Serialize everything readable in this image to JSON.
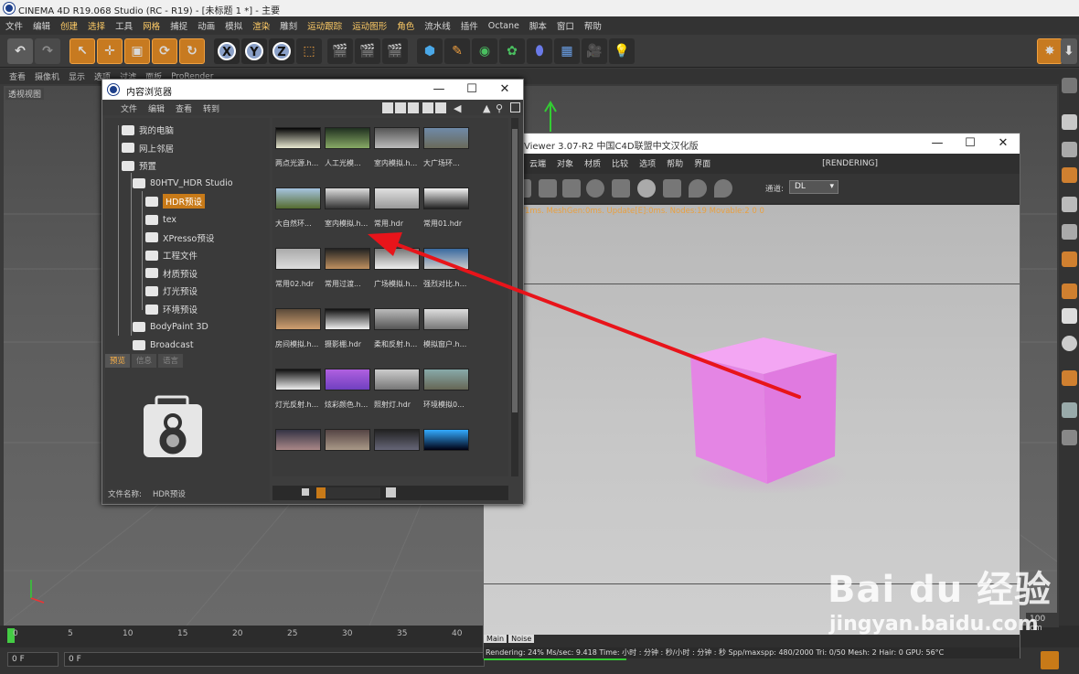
{
  "app": {
    "title": "CINEMA 4D R19.068 Studio (RC - R19) - [未标题 1 *] - 主要"
  },
  "menubar": [
    "文件",
    "编辑",
    "创建",
    "选择",
    "工具",
    "网格",
    "捕捉",
    "动画",
    "模拟",
    "渲染",
    "雕刻",
    "运动跟踪",
    "运动图形",
    "角色",
    "流水线",
    "插件",
    "Octane",
    "脚本",
    "窗口",
    "帮助"
  ],
  "subbar": [
    "查看",
    "摄像机",
    "显示",
    "选项",
    "过滤",
    "面板",
    "ProRender"
  ],
  "viewport": {
    "label": "透视视图"
  },
  "browser": {
    "title": "内容浏览器",
    "menu": [
      "文件",
      "编辑",
      "查看",
      "转到"
    ],
    "tree": [
      "我的电脑",
      "网上邻居",
      "预置",
      "80HTV_HDR Studio",
      "HDR预设",
      "tex",
      "XPresso预设",
      "工程文件",
      "材质预设",
      "灯光预设",
      "环境预设",
      "BodyPaint 3D",
      "Broadcast"
    ],
    "tabs": [
      "预览",
      "信息",
      "语言"
    ],
    "file_name_label": "文件名称:",
    "file_name_value": "HDR预设",
    "items": [
      "两点光源.h...",
      "人工光模...",
      "室内模拟.h...",
      "大广场环...",
      "大自然环...",
      "室内模拟.h...",
      "常用.hdr",
      "常用01.hdr",
      "常用02.hdr",
      "常用过渡...",
      "广场模拟.h...",
      "强烈对比.h...",
      "房间模拟.h...",
      "摄影棚.hdr",
      "柔和反射.h...",
      "模拟窗户.h...",
      "灯光反射.h...",
      "炫彩颜色.h...",
      "照射灯.hdr",
      "环境模拟0...",
      "",
      "",
      "",
      ""
    ],
    "thumb_colors": [
      [
        "#050505",
        "#e8e8d0"
      ],
      [
        "#203020",
        "#88aa66"
      ],
      [
        "#555",
        "#bbb"
      ],
      [
        "#6f8aa8",
        "#6a6a5a"
      ],
      [
        "#a6c4e0",
        "#556b2f"
      ],
      [
        "#ddd",
        "#333"
      ],
      [
        "#e0e0e0",
        "#999"
      ],
      [
        "#f2f2f2",
        "#222"
      ],
      [
        "#aaa",
        "#ddd"
      ],
      [
        "#222",
        "#c09060"
      ],
      [
        "#777",
        "#eee"
      ],
      [
        "#3a6aa0",
        "#ccc"
      ],
      [
        "#5a4a3a",
        "#d0a070"
      ],
      [
        "#111",
        "#f0f0f0"
      ],
      [
        "#bbb",
        "#555"
      ],
      [
        "#ddd",
        "#777"
      ],
      [
        "#111",
        "#eee"
      ],
      [
        "#b060e0",
        "#7040c0"
      ],
      [
        "#ccc",
        "#777"
      ],
      [
        "#8aa",
        "#665"
      ],
      [
        "#334",
        "#a88"
      ],
      [
        "#544",
        "#a98"
      ],
      [
        "#222",
        "#667"
      ],
      [
        "#3af",
        "#001"
      ]
    ]
  },
  "render": {
    "title": "Viewer 3.07-R2 中国C4D联盟中文汉化版",
    "menu": [
      "云端",
      "对象",
      "材质",
      "比较",
      "选项",
      "帮助",
      "界面"
    ],
    "rendering_tag": "[RENDERING]",
    "channel_label": "通道:",
    "channel_value": "DL",
    "log": "s./1ms. MeshGen:0ms. Update[E]:0ms. Nodes:19 Movable:2  0 0",
    "status": "Rendering: 24%  Ms/sec: 9.418   Time: 小时 : 分钟 : 秒/小时 : 分钟 : 秒   Spp/maxspp: 480/2000   Tri: 0/50   Mesh: 2   Hair: 0   GPU:    56°C",
    "tabs": [
      "Main",
      "Noise"
    ],
    "cube_color": "#e685e6"
  },
  "timeline": {
    "ticks": [
      "0",
      "5",
      "10",
      "15",
      "20",
      "25",
      "30",
      "35",
      "40"
    ],
    "frame_a": "0 F",
    "frame_b": "0 F",
    "scale": "100 cm"
  },
  "watermark": {
    "brand": "Bai du 经验",
    "url": "jingyan.baidu.com"
  },
  "colors": {
    "accent": "#c87a18",
    "arrow": "#e8141a"
  }
}
